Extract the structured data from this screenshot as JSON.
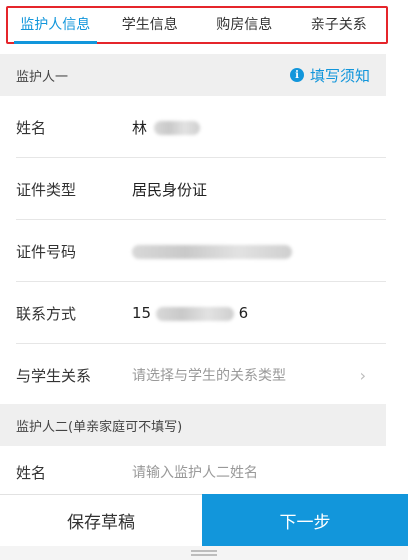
{
  "tabs": [
    {
      "label": "监护人信息",
      "active": true
    },
    {
      "label": "学生信息",
      "active": false
    },
    {
      "label": "购房信息",
      "active": false
    },
    {
      "label": "亲子关系",
      "active": false
    }
  ],
  "section1": {
    "title": "监护人一",
    "notice_label": "填写须知",
    "fields": [
      {
        "label": "姓名",
        "value": "林"
      },
      {
        "label": "证件类型",
        "value": "居民身份证"
      },
      {
        "label": "证件号码",
        "value": ""
      },
      {
        "label": "联系方式",
        "value_start": "15",
        "value_end": "6"
      },
      {
        "label": "与学生关系",
        "placeholder": "请选择与学生的关系类型"
      }
    ]
  },
  "section2": {
    "title": "监护人二(单亲家庭可不填写)",
    "fields": [
      {
        "label": "姓名",
        "placeholder": "请输入监护人二姓名"
      }
    ]
  },
  "actions": {
    "save_draft": "保存草稿",
    "next": "下一步"
  },
  "colors": {
    "accent": "#1296db",
    "highlight_border": "#e5252b"
  },
  "icons": {
    "notice": "info-icon",
    "chevron": "chevron-right-icon"
  }
}
